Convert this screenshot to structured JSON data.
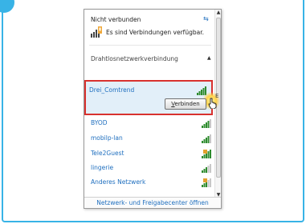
{
  "status": {
    "title": "Nicht verbunden",
    "message": "Es sind Verbindungen verfügbar."
  },
  "section": {
    "label": "Drahtlosnetzwerkverbindung"
  },
  "selected_network": {
    "name": "Drei_Comtrend",
    "connect_prefix": "",
    "connect_access_key": "V",
    "connect_rest": "erbinden"
  },
  "side_mark": "E",
  "networks": [
    {
      "name": "BYOD",
      "secured": false
    },
    {
      "name": "mobilp-lan",
      "secured": false
    },
    {
      "name": "Tele2Guest",
      "secured": true
    },
    {
      "name": "lingerie",
      "secured": false
    },
    {
      "name": "Anderes Netzwerk",
      "secured": true
    }
  ],
  "footer": {
    "link": "Netzwerk- und Freigabecenter öffnen"
  },
  "colors": {
    "accent_frame": "#38b3e6",
    "highlight_border": "#d8312e",
    "link": "#1f6fbf",
    "signal": "#2e8b2e"
  }
}
